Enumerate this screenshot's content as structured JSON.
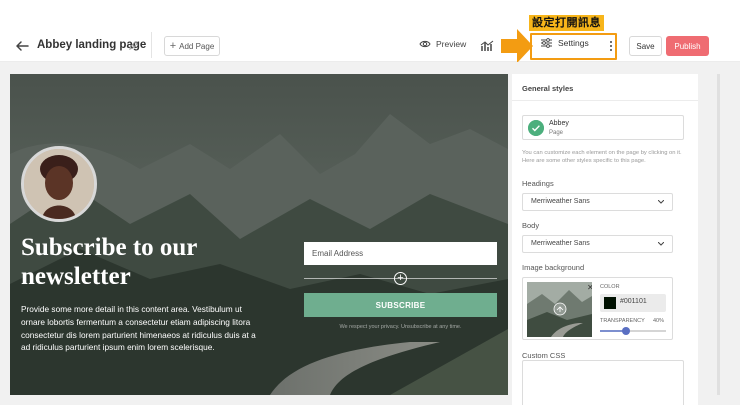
{
  "header": {
    "page_title": "Abbey landing page",
    "add_page_label": "Add Page",
    "preview_label": "Preview",
    "settings_label": "Settings",
    "save_label": "Save",
    "publish_label": "Publish",
    "annotation": "設定打開訊息",
    "publish_color": "#ef6c72",
    "annotation_color": "#f7b51a"
  },
  "hero": {
    "title": "Subscribe to our newsletter",
    "body": "Provide some more detail in this content area. Vestibulum ut ornare lobortis fermentum a consectetur etiam adipiscing litora consectetur dis lorem parturient himenaeos at ridiculus duis at a ad ridiculus parturient ipsum enim lorem scelerisque.",
    "email_placeholder": "Email Address",
    "subscribe_label": "SUBSCRIBE",
    "privacy_text": "We respect your privacy. Unsubscribe at any time.",
    "accent_color": "#6fae8f"
  },
  "panel": {
    "heading": "General styles",
    "theme_name": "Abbey",
    "theme_sub": "Page",
    "hint": "You can customize each element on the page by clicking on it. Here are some other styles specific to this page.",
    "headings_label": "Headings",
    "headings_font": "Merriweather Sans",
    "body_label": "Body",
    "body_font": "Merriweather Sans",
    "image_bg_label": "Image background",
    "color_label": "COLOR",
    "color_hex": "#001101",
    "transparency_label": "TRANSPARENCY",
    "transparency_value": "40%",
    "transparency_fraction": 0.4,
    "custom_css_label": "Custom CSS"
  }
}
